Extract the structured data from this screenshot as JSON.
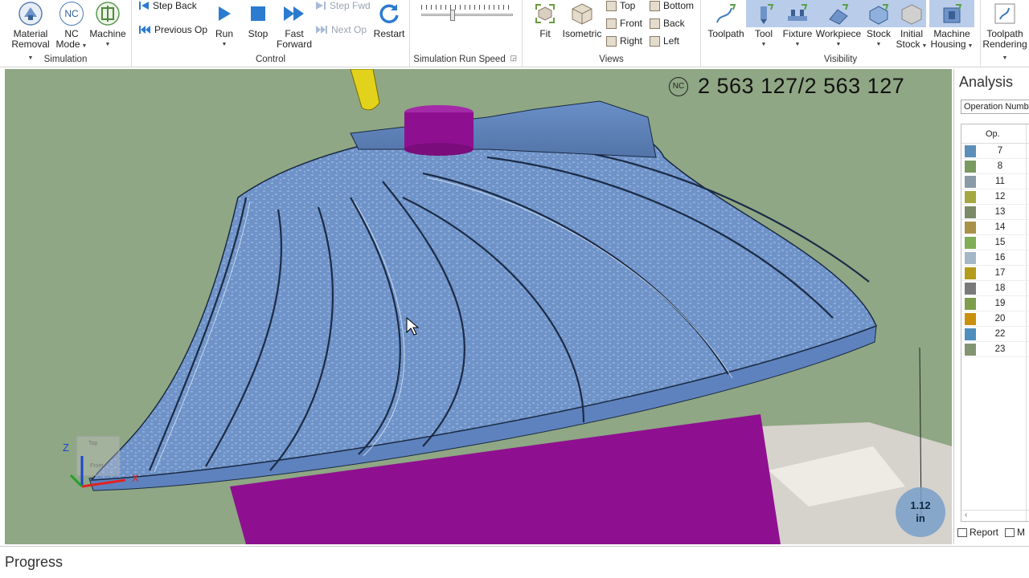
{
  "ribbon": {
    "simulation": {
      "label": "Simulation",
      "material_removal": [
        "Material",
        "Removal"
      ],
      "nc_mode": [
        "NC",
        "Mode"
      ],
      "nc_badge": "NC",
      "machine": "Machine"
    },
    "control": {
      "label": "Control",
      "step_back": "Step Back",
      "previous_op": "Previous Op",
      "run": "Run",
      "stop": "Stop",
      "fast_forward": [
        "Fast",
        "Forward"
      ],
      "step_fwd": "Step Fwd",
      "next_op": "Next Op",
      "restart": "Restart"
    },
    "speed": {
      "label": "Simulation Run Speed",
      "level": 0.33
    },
    "views": {
      "label": "Views",
      "fit": "Fit",
      "isometric": "Isometric",
      "top": "Top",
      "front": "Front",
      "right": "Right",
      "bottom": "Bottom",
      "back": "Back",
      "left": "Left"
    },
    "visibility": {
      "label": "Visibility",
      "toolpath": "Toolpath",
      "tool": "Tool",
      "fixture": "Fixture",
      "workpiece": "Workpiece",
      "stock": "Stock",
      "initial_stock": [
        "Initial",
        "Stock"
      ],
      "machine_housing": [
        "Machine",
        "Housing"
      ]
    },
    "toolpath_rendering": [
      "Toolpath",
      "Rendering"
    ]
  },
  "viewport": {
    "counter_badge": "NC",
    "counter": "2 563 127/2 563 127",
    "scale": [
      "1.12",
      "in"
    ],
    "axes": {
      "z": "Z",
      "x": "X"
    },
    "cube": {
      "top": "Top",
      "front": "Front"
    },
    "colors": {
      "background": "#8fa784",
      "part": "#6f93c8",
      "stock": "#8e1090",
      "tool": "#e3d21c"
    }
  },
  "analysis": {
    "title": "Analysis",
    "select": "Operation Number",
    "header": "Op.",
    "rows": [
      {
        "op": "7",
        "color": "#5b8fb9"
      },
      {
        "op": "8",
        "color": "#7a9a62"
      },
      {
        "op": "11",
        "color": "#8a9aa6"
      },
      {
        "op": "12",
        "color": "#a5a840"
      },
      {
        "op": "13",
        "color": "#7d8a67"
      },
      {
        "op": "14",
        "color": "#a89247"
      },
      {
        "op": "15",
        "color": "#80ad58"
      },
      {
        "op": "16",
        "color": "#a3b7c6"
      },
      {
        "op": "17",
        "color": "#b49c1d"
      },
      {
        "op": "18",
        "color": "#7a7a7a"
      },
      {
        "op": "19",
        "color": "#7f9e4d"
      },
      {
        "op": "20",
        "color": "#c9900e"
      },
      {
        "op": "22",
        "color": "#4f8ebd"
      },
      {
        "op": "23",
        "color": "#839473"
      }
    ],
    "tabs": [
      "Report",
      "M"
    ]
  },
  "progress": {
    "label": "Progress"
  }
}
